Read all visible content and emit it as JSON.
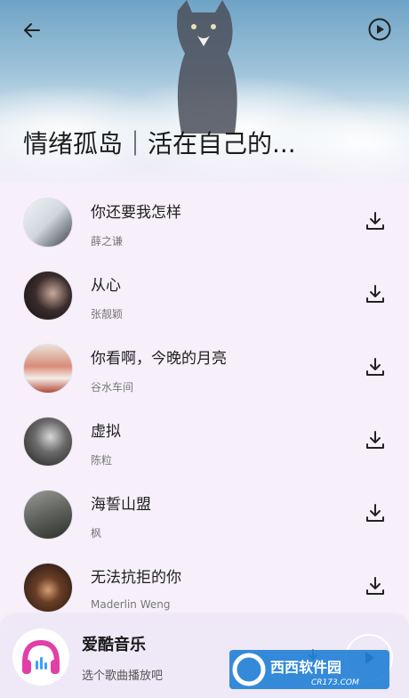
{
  "header": {
    "back_icon": "arrow-left-icon",
    "play_all_icon": "play-circle-icon",
    "playlist_title": "情绪孤岛｜活在自己的..."
  },
  "songs": [
    {
      "title": "你还要我怎样",
      "artist": "薛之谦"
    },
    {
      "title": "从心",
      "artist": "张靓颖"
    },
    {
      "title": "你看啊，今晚的月亮",
      "artist": "谷水车间"
    },
    {
      "title": "虚拟",
      "artist": "陈粒"
    },
    {
      "title": "海誓山盟",
      "artist": "枫"
    },
    {
      "title": "无法抗拒的你",
      "artist": "Maderlin Weng"
    }
  ],
  "player": {
    "app_name": "爱酷音乐",
    "hint": "选个歌曲播放吧"
  },
  "watermark": {
    "brand": "西西软件园",
    "url": "CR173.COM"
  },
  "colors": {
    "logo_pink": "#e040a8",
    "logo_blue": "#3aa0ff",
    "background": "#f7f0fb"
  }
}
